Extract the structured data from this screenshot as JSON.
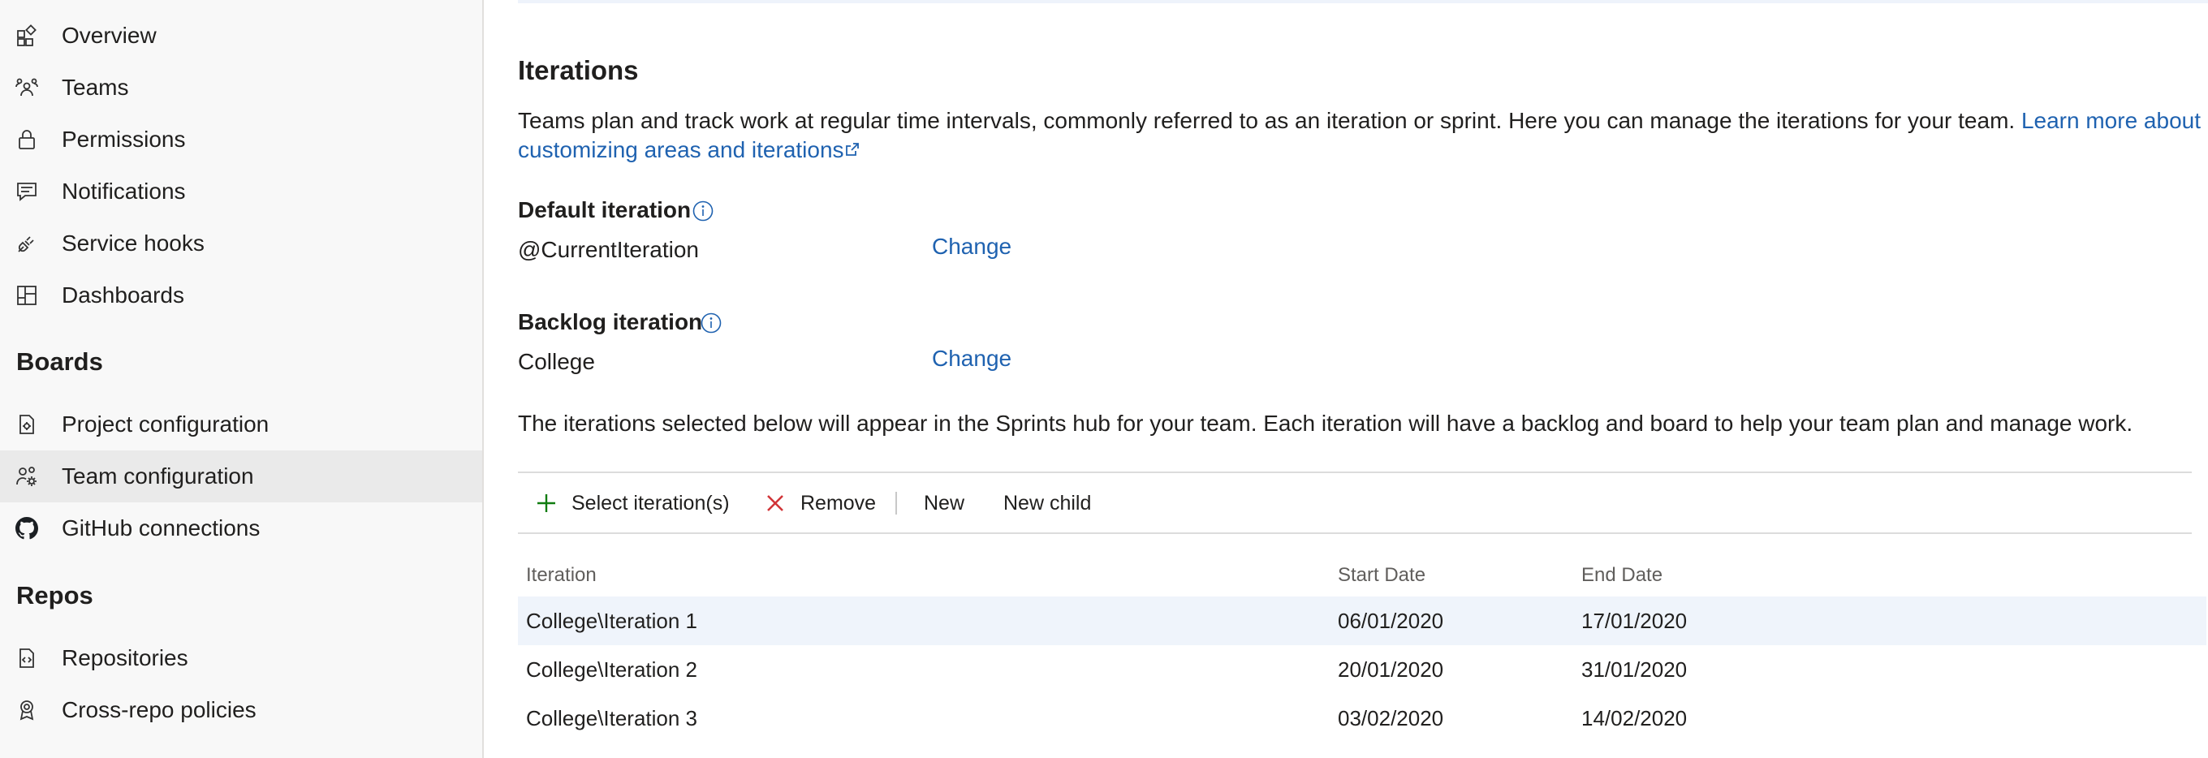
{
  "sidebar": {
    "general_items": [
      {
        "label": "Overview",
        "icon": "overview-icon"
      },
      {
        "label": "Teams",
        "icon": "teams-icon"
      },
      {
        "label": "Permissions",
        "icon": "lock-icon"
      },
      {
        "label": "Notifications",
        "icon": "chat-icon"
      },
      {
        "label": "Service hooks",
        "icon": "plug-icon"
      },
      {
        "label": "Dashboards",
        "icon": "dashboard-icon"
      }
    ],
    "boards_title": "Boards",
    "boards_items": [
      {
        "label": "Project configuration",
        "icon": "settings-doc-icon"
      },
      {
        "label": "Team configuration",
        "icon": "team-settings-icon",
        "selected": true
      },
      {
        "label": "GitHub connections",
        "icon": "github-icon"
      }
    ],
    "repos_title": "Repos",
    "repos_items": [
      {
        "label": "Repositories",
        "icon": "code-file-icon"
      },
      {
        "label": "Cross-repo policies",
        "icon": "ribbon-icon"
      }
    ]
  },
  "main": {
    "title": "Iterations",
    "description": "Teams plan and track work at regular time intervals, commonly referred to as an iteration or sprint. Here you can manage the iterations for your team.",
    "learn_more_link": "Learn more about customizing areas and iterations",
    "default_iteration": {
      "label": "Default iteration",
      "value": "@CurrentIteration",
      "change_label": "Change"
    },
    "backlog_iteration": {
      "label": "Backlog iteration",
      "value": "College",
      "change_label": "Change"
    },
    "info_text": "The iterations selected below will appear in the Sprints hub for your team. Each iteration will have a backlog and board to help your team plan and manage work.",
    "toolbar": {
      "select_label": "Select iteration(s)",
      "remove_label": "Remove",
      "new_label": "New",
      "new_child_label": "New child"
    },
    "table": {
      "headers": [
        "Iteration",
        "Start Date",
        "End Date"
      ],
      "rows": [
        {
          "iteration": "College\\Iteration 1",
          "start": "06/01/2020",
          "end": "17/01/2020",
          "selected": true
        },
        {
          "iteration": "College\\Iteration 2",
          "start": "20/01/2020",
          "end": "31/01/2020"
        },
        {
          "iteration": "College\\Iteration 3",
          "start": "03/02/2020",
          "end": "14/02/2020"
        }
      ]
    }
  },
  "colors": {
    "link": "#1f62b0",
    "add_green": "#107c10",
    "remove_red": "#d13438",
    "selected_row": "#eff4fb",
    "sidebar_bg": "#f8f8f8"
  }
}
